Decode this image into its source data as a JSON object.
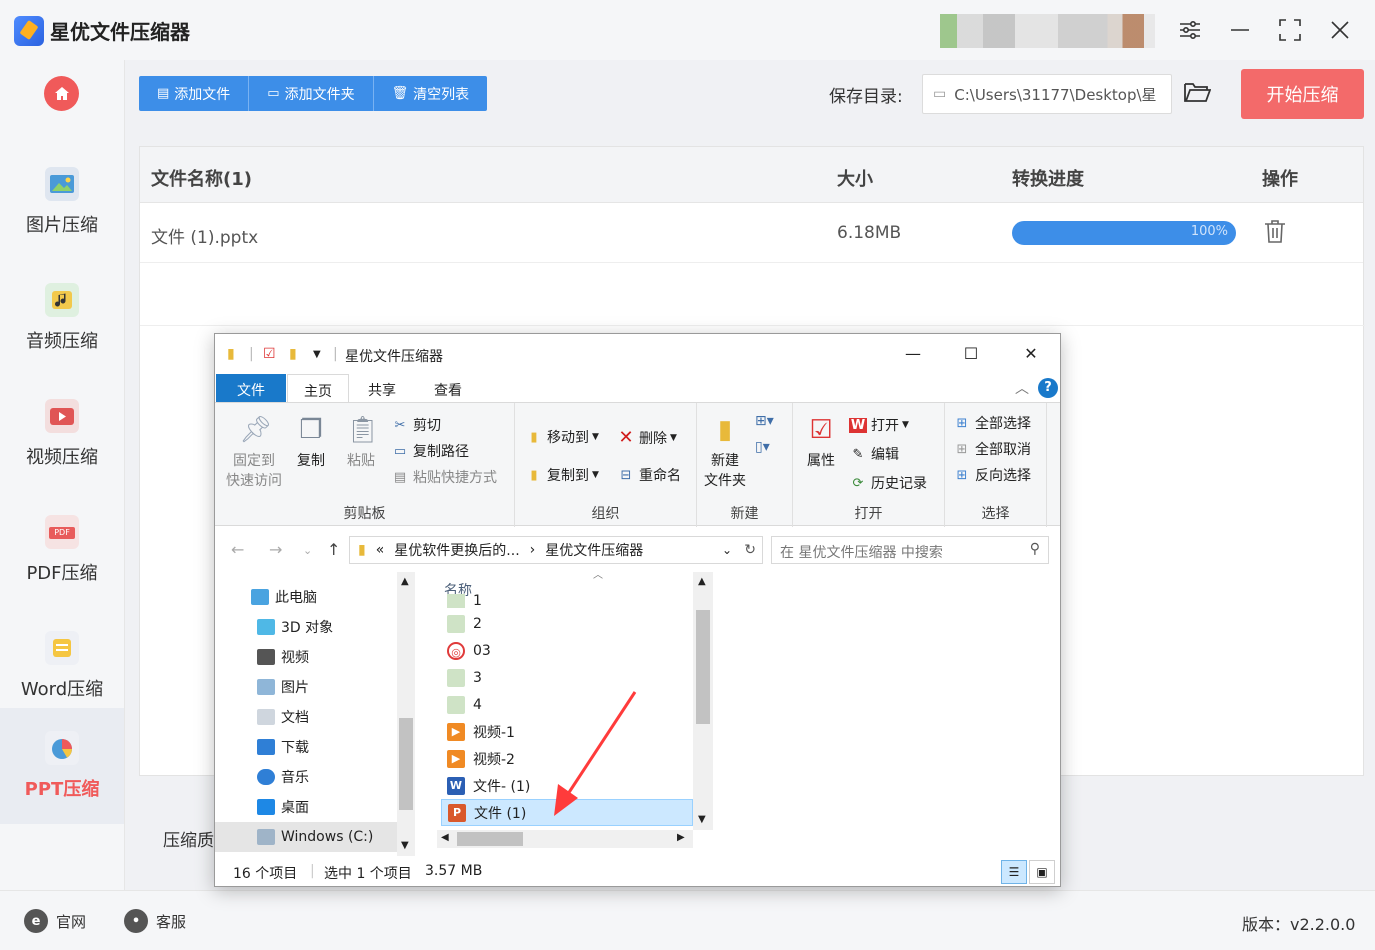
{
  "app": {
    "title": "星优文件压缩器"
  },
  "sidebar": {
    "items": [
      {
        "label": "图片压缩",
        "icon": "image-icon"
      },
      {
        "label": "音频压缩",
        "icon": "audio-icon"
      },
      {
        "label": "视频压缩",
        "icon": "video-icon"
      },
      {
        "label": "PDF压缩",
        "icon": "pdf-icon",
        "badge": "PDF"
      },
      {
        "label": "Word压缩",
        "icon": "word-icon"
      },
      {
        "label": "PPT压缩",
        "icon": "ppt-icon",
        "active": true
      }
    ]
  },
  "toolbar": {
    "add_file": "添加文件",
    "add_folder": "添加文件夹",
    "clear_list": "清空列表",
    "save_dir_label": "保存目录:",
    "save_dir_value": "C:\\Users\\31177\\Desktop\\星",
    "start": "开始压缩"
  },
  "table": {
    "headers": [
      "文件名称(1)",
      "大小",
      "转换进度",
      "操作"
    ],
    "rows": [
      {
        "name": "文件 (1).pptx",
        "size": "6.18MB",
        "progress_label": "100%",
        "progress": 1.0
      }
    ]
  },
  "quality_label": "压缩质",
  "footer": {
    "website": "官网",
    "support": "客服",
    "version": "版本：v2.2.0.0"
  },
  "explorer": {
    "title": "星优文件压缩器",
    "tabs": [
      "文件",
      "主页",
      "共享",
      "查看"
    ],
    "ribbon": {
      "clipboard": {
        "group": "剪贴板",
        "pin": "固定到\n快速访问",
        "pin_line1": "固定到",
        "pin_line2": "快速访问",
        "copy": "复制",
        "paste": "粘贴",
        "cut": "剪切",
        "copy_path": "复制路径",
        "paste_shortcut": "粘贴快捷方式"
      },
      "organize": {
        "group": "组织",
        "move_to": "移动到",
        "copy_to": "复制到",
        "delete": "删除",
        "rename": "重命名"
      },
      "new": {
        "group": "新建",
        "new_folder_line1": "新建",
        "new_folder_line2": "文件夹"
      },
      "open": {
        "group": "打开",
        "properties": "属性",
        "open": "打开",
        "edit": "编辑",
        "history": "历史记录"
      },
      "select": {
        "group": "选择",
        "select_all": "全部选择",
        "select_none": "全部取消",
        "invert": "反向选择"
      }
    },
    "address": {
      "prefix": "«",
      "part1": "星优软件更换后的...",
      "sep": "›",
      "part2": "星优文件压缩器"
    },
    "search_placeholder": "在 星优文件压缩器 中搜索",
    "nav_items": [
      {
        "label": "此电脑",
        "icon": "computer-icon"
      },
      {
        "label": "3D 对象",
        "icon": "3d-objects-icon"
      },
      {
        "label": "视频",
        "icon": "videos-folder-icon"
      },
      {
        "label": "图片",
        "icon": "pictures-folder-icon"
      },
      {
        "label": "文档",
        "icon": "documents-folder-icon"
      },
      {
        "label": "下载",
        "icon": "downloads-folder-icon"
      },
      {
        "label": "音乐",
        "icon": "music-folder-icon"
      },
      {
        "label": "桌面",
        "icon": "desktop-folder-icon"
      },
      {
        "label": "Windows (C:)",
        "icon": "drive-icon"
      }
    ],
    "column_name": "名称",
    "files": [
      {
        "name": "1",
        "type": "image"
      },
      {
        "name": "2",
        "type": "image"
      },
      {
        "name": "03",
        "type": "audio"
      },
      {
        "name": "3",
        "type": "image"
      },
      {
        "name": "4",
        "type": "image"
      },
      {
        "name": "视频-1",
        "type": "video"
      },
      {
        "name": "视频-2",
        "type": "video"
      },
      {
        "name": "文件- (1)",
        "type": "word"
      },
      {
        "name": "文件 (1)",
        "type": "ppt",
        "selected": true
      }
    ],
    "status": {
      "count": "16 个项目",
      "selected": "选中 1 个项目",
      "size": "3.57 MB"
    }
  },
  "colors": {
    "accent_blue": "#3d8ee8",
    "accent_red": "#f36a6a",
    "explorer_blue": "#1979ca"
  }
}
